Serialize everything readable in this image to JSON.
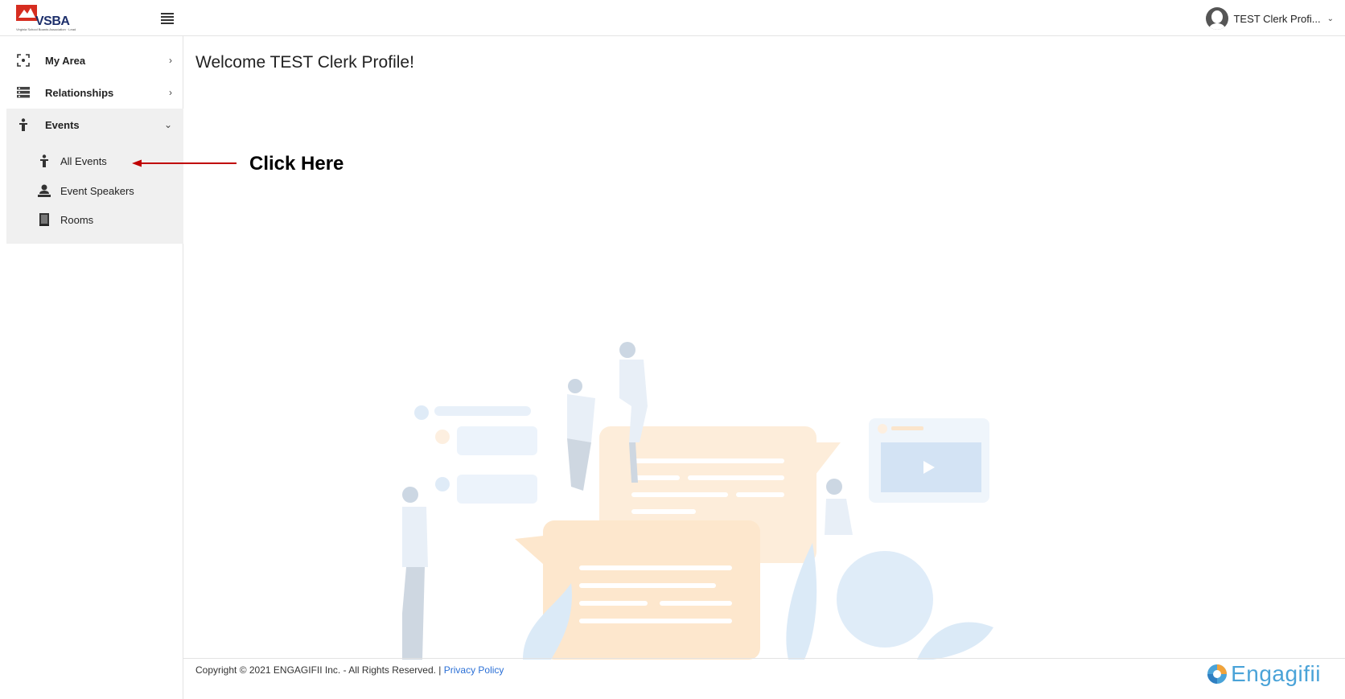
{
  "header": {
    "logo_text": "VSBA",
    "logo_tagline": "Virginia School Boards Association · Leadership · Advocacy · Support",
    "user_name": "TEST Clerk Profi...",
    "user_caret": "⌄"
  },
  "sidebar": {
    "items": [
      {
        "label": "My Area",
        "chevron": "›",
        "icon": "focus-icon"
      },
      {
        "label": "Relationships",
        "chevron": "›",
        "icon": "list-icon"
      },
      {
        "label": "Events",
        "chevron": "⌄",
        "icon": "person-icon"
      }
    ],
    "events_sub": [
      {
        "label": "All Events",
        "icon": "person-icon"
      },
      {
        "label": "Event Speakers",
        "icon": "speaker-icon"
      },
      {
        "label": "Rooms",
        "icon": "door-icon"
      }
    ]
  },
  "main": {
    "welcome": "Welcome TEST Clerk Profile!",
    "annotation": "Click Here"
  },
  "footer": {
    "copyright": "Copyright © 2021 ENGAGIFII Inc. - All Rights Reserved. | ",
    "privacy": "Privacy Policy",
    "brand": "Engagifii"
  },
  "colors": {
    "accent_link": "#2a6fd6",
    "annotation_arrow": "#c00000",
    "logo_red": "#d62d20",
    "brand_blue": "#4aa3d8"
  }
}
